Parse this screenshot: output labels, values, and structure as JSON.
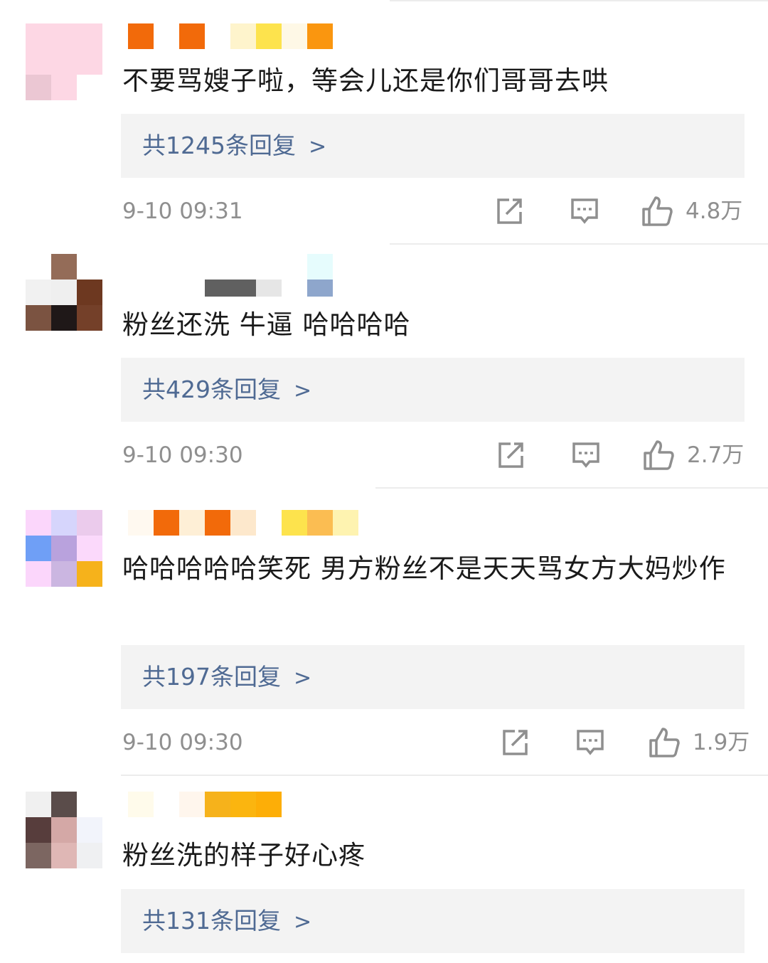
{
  "comments": [
    {
      "text": "不要骂嫂子啦，等会儿还是你们哥哥去哄",
      "replies_label": "共1245条回复",
      "time": "9-10 09:31",
      "likes": "4.8万"
    },
    {
      "text": "粉丝还洗 牛逼 哈哈哈哈",
      "replies_label": "共429条回复",
      "time": "9-10 09:30",
      "likes": "2.7万"
    },
    {
      "text": "哈哈哈哈哈笑死  男方粉丝不是天天骂女方大妈炒作",
      "replies_label": "共197条回复",
      "time": "9-10 09:30",
      "likes": "1.9万"
    },
    {
      "text": "粉丝洗的样子好心疼",
      "replies_label": "共131条回复"
    }
  ],
  "icons": {
    "share": "share-icon",
    "comment": "comment-icon",
    "like": "thumbs-up-icon",
    "chevron": "chevron-right-icon"
  },
  "colors": {
    "reply_link": "#4f6a93",
    "meta_gray": "#8f8f8f",
    "reply_bg": "#f3f3f3"
  }
}
